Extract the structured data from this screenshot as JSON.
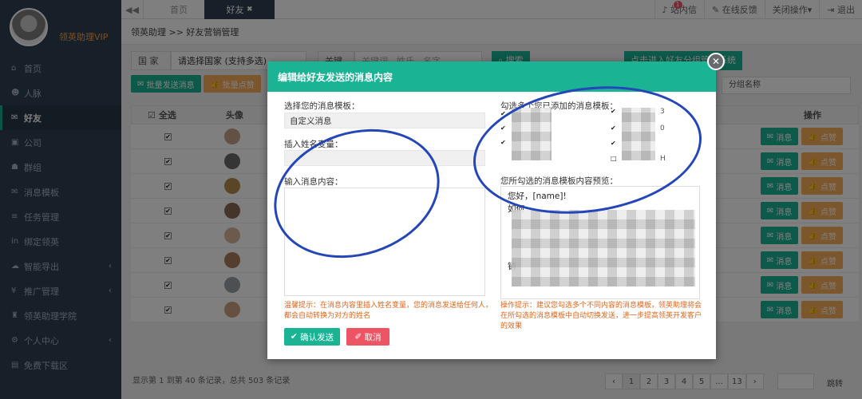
{
  "user": {
    "vip_label": "领英助理VIP"
  },
  "sidebar": {
    "items": [
      {
        "label": "首页",
        "icon": "home-icon",
        "glyph": "⌂"
      },
      {
        "label": "人脉",
        "icon": "users-icon",
        "glyph": "☻"
      },
      {
        "label": "好友",
        "icon": "chat-icon",
        "glyph": "✉",
        "active": true
      },
      {
        "label": "公司",
        "icon": "briefcase-icon",
        "glyph": "▣"
      },
      {
        "label": "群组",
        "icon": "group-icon",
        "glyph": "☗"
      },
      {
        "label": "消息模板",
        "icon": "envelope-icon",
        "glyph": "✉"
      },
      {
        "label": "任务管理",
        "icon": "list-icon",
        "glyph": "≡"
      },
      {
        "label": "绑定领英",
        "icon": "linkedin-icon",
        "glyph": "in"
      },
      {
        "label": "智能导出",
        "icon": "cloud-icon",
        "glyph": "☁",
        "arrow": "‹"
      },
      {
        "label": "推广管理",
        "icon": "yen-icon",
        "glyph": "¥",
        "arrow": "‹"
      },
      {
        "label": "领英助理学院",
        "icon": "graduation-icon",
        "glyph": "♜"
      },
      {
        "label": "个人中心",
        "icon": "gear-icon",
        "glyph": "⚙",
        "arrow": "‹"
      },
      {
        "label": "免费下载区",
        "icon": "file-icon",
        "glyph": "▤"
      }
    ]
  },
  "topbar": {
    "back_glyph": "◀◀",
    "tab_home": "首页",
    "tab_friends": "好友",
    "tab_close": "✖",
    "notify_label": "站内信",
    "notify_count": "1",
    "feedback_label": "在线反馈",
    "close_ops_label": "关闭操作▾",
    "logout_label": "退出"
  },
  "main": {
    "breadcrumb": "领英助理 >> 好友营销管理",
    "country_label": "国 家",
    "country_select": "请选择国家 (支持多选)",
    "keyword_label": "关键词",
    "keyword_placeholder": "关键词、姓氏、名字",
    "search_btn": "搜索",
    "group_btn": "点击进入好友分组管理系统",
    "bulk_send": "批量发送消息",
    "bulk_like": "批量点赞",
    "group_name_select": "分组名称",
    "col_select_all": "全选",
    "col_avatar": "头像",
    "col_actions": "操作",
    "row_msg_btn": "消息",
    "row_like_btn": "点赞",
    "footer_info": "显示第 1 到第 40 条记录，总共 503 条记录",
    "pages": [
      "‹",
      "1",
      "2",
      "3",
      "4",
      "5",
      "...",
      "13",
      "›"
    ],
    "goto_label": "跳转"
  },
  "modal": {
    "title": "编辑给好友发送的消息内容",
    "close_glyph": "✕",
    "template_label": "选择您的消息模板：",
    "template_value": "自定义消息",
    "name_var_label": "插入姓名变量：",
    "content_label": "输入消息内容：",
    "tip_left": "温馨提示：在消息内容里插入姓名变量，您的消息发送给任何人，都会自动转换为对方的姓名",
    "confirm_btn": "确认发送",
    "cancel_btn": "取消",
    "added_templates_label": "勾选多个您已添加的消息模板：",
    "preview_label": "您所勾选的消息模板内容预览：",
    "preview_line1": "您好，[name]!",
    "preview_line2": "如何",
    "preview_line3": "销",
    "tip_right": "操作提示：建议您勾选多个不同内容的消息模板，领英助理将会在所勾选的消息模板中自动切换发送，进一步提高领英开发客户的效果",
    "tpl_suffix_1": "3",
    "tpl_suffix_2": "0",
    "tpl_suffix_3": "H"
  },
  "colors": {
    "accent": "#1ab394",
    "orange": "#f8ac59",
    "sidebar": "#2f4050",
    "danger": "#ed5565",
    "annotation": "#2546b8"
  }
}
